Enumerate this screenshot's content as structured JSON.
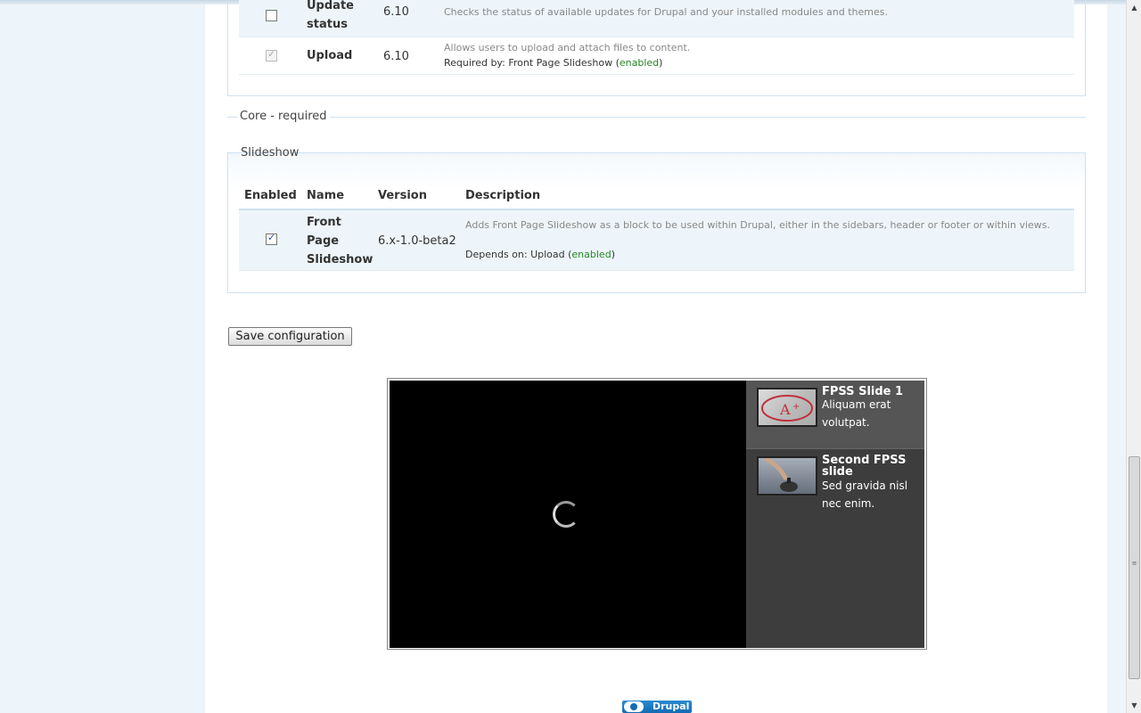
{
  "modules_top": [
    {
      "enabled": false,
      "disabled": false,
      "name": "Update status",
      "version": "6.10",
      "description": "Checks the status of available updates for Drupal and your installed modules and themes."
    },
    {
      "enabled": true,
      "disabled": true,
      "name": "Upload",
      "version": "6.10",
      "description": "Allows users to upload and attach files to content.",
      "required_by_label": "Required by: Front Page Slideshow (",
      "required_by_status": "enabled",
      "required_by_close": ")"
    }
  ],
  "core_required_legend": "Core - required",
  "slideshow_fieldset": {
    "legend": "Slideshow",
    "headers": {
      "enabled": "Enabled",
      "name": "Name",
      "version": "Version",
      "description": "Description"
    },
    "module": {
      "enabled": true,
      "name": "Front Page Slideshow",
      "version": "6.x-1.0-beta2",
      "description": "Adds Front Page Slideshow as a block to be used within Drupal, either in the sidebars, header or footer or within views.",
      "depends_label": "Depends on: Upload (",
      "depends_status": "enabled",
      "depends_close": ")"
    }
  },
  "save_button": "Save configuration",
  "slideshow": {
    "slides": [
      {
        "title": "FPSS Slide 1",
        "text": "Aliquam erat volutpat.",
        "active": true,
        "thumb_icon": "grade-a-paper-thumb"
      },
      {
        "title": "Second FPSS slide",
        "text": "Sed gravida nisl nec enim.",
        "active": false,
        "thumb_icon": "desk-bell-thumb"
      }
    ]
  },
  "footer": {
    "badge": "Drupal"
  }
}
